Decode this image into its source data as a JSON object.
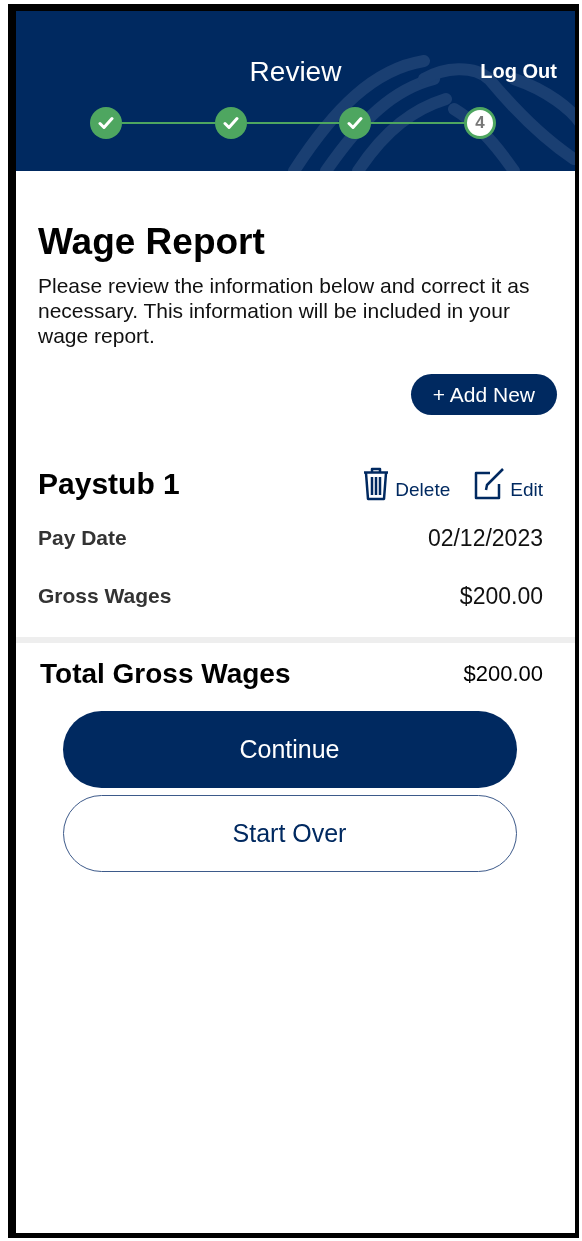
{
  "header": {
    "title": "Review",
    "logout": "Log Out",
    "steps": [
      {
        "done": true
      },
      {
        "done": true
      },
      {
        "done": true
      },
      {
        "done": false,
        "number": "4"
      }
    ]
  },
  "report": {
    "title": "Wage Report",
    "intro": "Please review the information below and correct it as necessary. This information will be included in your wage report.",
    "add_button": "+ Add New"
  },
  "paystubs": [
    {
      "title": "Paystub 1",
      "delete": "Delete",
      "edit": "Edit",
      "fields": [
        {
          "label": "Pay Date",
          "value": "02/12/2023"
        },
        {
          "label": "Gross Wages",
          "value": "$200.00"
        }
      ]
    }
  ],
  "total": {
    "label": "Total Gross Wages",
    "value": "$200.00"
  },
  "buttons": [
    {
      "label": "Continue",
      "kind": "primary"
    },
    {
      "label": "Start Over",
      "kind": "secondary"
    }
  ]
}
